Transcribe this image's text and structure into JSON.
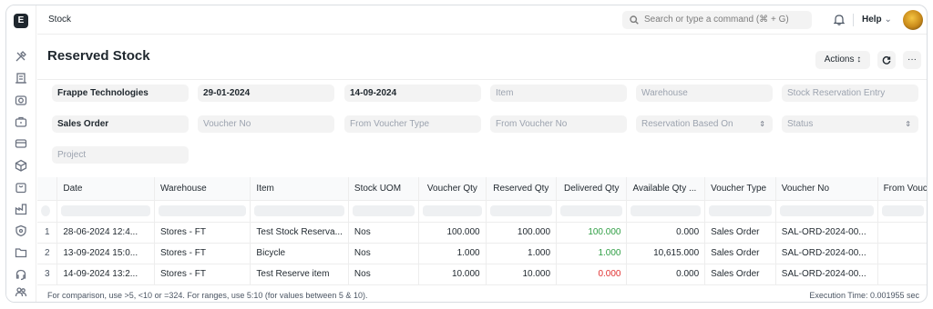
{
  "app": {
    "logo_letter": "E",
    "breadcrumb": "Stock"
  },
  "search": {
    "placeholder": "Search or type a command (⌘ + G)"
  },
  "help": {
    "label": "Help",
    "chevron": "⌄"
  },
  "page": {
    "title": "Reserved Stock"
  },
  "toolbar": {
    "actions_label": "Actions ↕",
    "more_label": "···"
  },
  "filters": [
    {
      "name": "company-filter",
      "value": "Frappe Technologies",
      "filled": true
    },
    {
      "name": "from-date-filter",
      "value": "29-01-2024",
      "filled": true
    },
    {
      "name": "to-date-filter",
      "value": "14-09-2024",
      "filled": true
    },
    {
      "name": "item-filter",
      "value": "Item",
      "filled": false
    },
    {
      "name": "warehouse-filter",
      "value": "Warehouse",
      "filled": false
    },
    {
      "name": "stock-reservation-entry-filter",
      "value": "Stock Reservation Entry",
      "filled": false
    },
    {
      "name": "voucher-type-filter",
      "value": "Sales Order",
      "filled": true
    },
    {
      "name": "voucher-no-filter",
      "value": "Voucher No",
      "filled": false
    },
    {
      "name": "from-voucher-type-filter",
      "value": "From Voucher Type",
      "filled": false
    },
    {
      "name": "from-voucher-no-filter",
      "value": "From Voucher No",
      "filled": false
    },
    {
      "name": "reservation-based-on-filter",
      "value": "Reservation Based On",
      "filled": false,
      "select": true
    },
    {
      "name": "status-filter",
      "value": "Status",
      "filled": false,
      "select": true
    },
    {
      "name": "project-filter",
      "value": "Project",
      "filled": false
    }
  ],
  "table": {
    "columns": [
      "Date",
      "Warehouse",
      "Item",
      "Stock UOM",
      "Voucher Qty",
      "Reserved Qty",
      "Delivered Qty",
      "Available Qty ...",
      "Voucher Type",
      "Voucher No",
      "From Vouc"
    ],
    "rows": [
      {
        "idx": "1",
        "cells": [
          "28-06-2024 12:4...",
          "Stores - FT",
          "Test Stock Reserva...",
          "Nos",
          "100.000",
          "100.000",
          "100.000",
          "0.000",
          "Sales Order",
          "SAL-ORD-2024-00...",
          ""
        ],
        "delivered_color": "green"
      },
      {
        "idx": "2",
        "cells": [
          "13-09-2024 15:0...",
          "Stores - FT",
          "Bicycle",
          "Nos",
          "1.000",
          "1.000",
          "1.000",
          "10,615.000",
          "Sales Order",
          "SAL-ORD-2024-00...",
          ""
        ],
        "delivered_color": "green"
      },
      {
        "idx": "3",
        "cells": [
          "14-09-2024 13:2...",
          "Stores - FT",
          "Test Reserve item",
          "Nos",
          "10.000",
          "10.000",
          "0.000",
          "0.000",
          "Sales Order",
          "SAL-ORD-2024-00...",
          ""
        ],
        "delivered_color": "red"
      }
    ]
  },
  "footer": {
    "hint": "For comparison, use >5, <10 or =324. For ranges, use 5:10 (for values between 5 & 10).",
    "execution_time": "Execution Time: 0.001955 sec"
  },
  "colors": {
    "green": "#2f9e44",
    "red": "#e03131",
    "accent": "#1f272e"
  },
  "icons": [
    "tools-icon",
    "building-icon",
    "camera-icon",
    "briefcase-icon",
    "credit-card-icon",
    "box-icon",
    "shopping-bag-icon",
    "factory-icon",
    "shield-icon",
    "folder-icon",
    "headset-icon",
    "users-icon",
    "search-icon",
    "bell-icon",
    "refresh-icon"
  ]
}
